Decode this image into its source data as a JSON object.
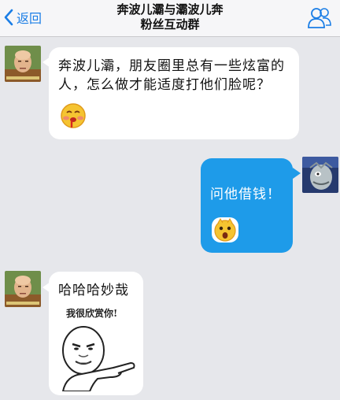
{
  "header": {
    "back_label": "返回",
    "title_line1": "奔波儿灞与灞波儿奔",
    "title_line2": "粉丝互动群"
  },
  "icons": {
    "back": "chevron-left-icon",
    "group": "group-members-icon",
    "emoji_drool": "drooling-face-emoji",
    "emoji_surprised": "surprised-face-emoji"
  },
  "colors": {
    "accent": "#1b7ee6",
    "outgoing_bubble": "#1e9be9",
    "incoming_bubble": "#ffffff",
    "background": "#e6e7eb"
  },
  "messages": [
    {
      "side": "incoming",
      "text_line1": "奔波儿灞，朋友圈里总有一些炫富的",
      "text_line2": "人，怎么做才能适度打他们脸呢？"
    },
    {
      "side": "outgoing",
      "text": "问他借钱！"
    },
    {
      "side": "incoming",
      "text": "哈哈哈妙哉",
      "sticker_caption": "我很欣赏你!"
    }
  ]
}
